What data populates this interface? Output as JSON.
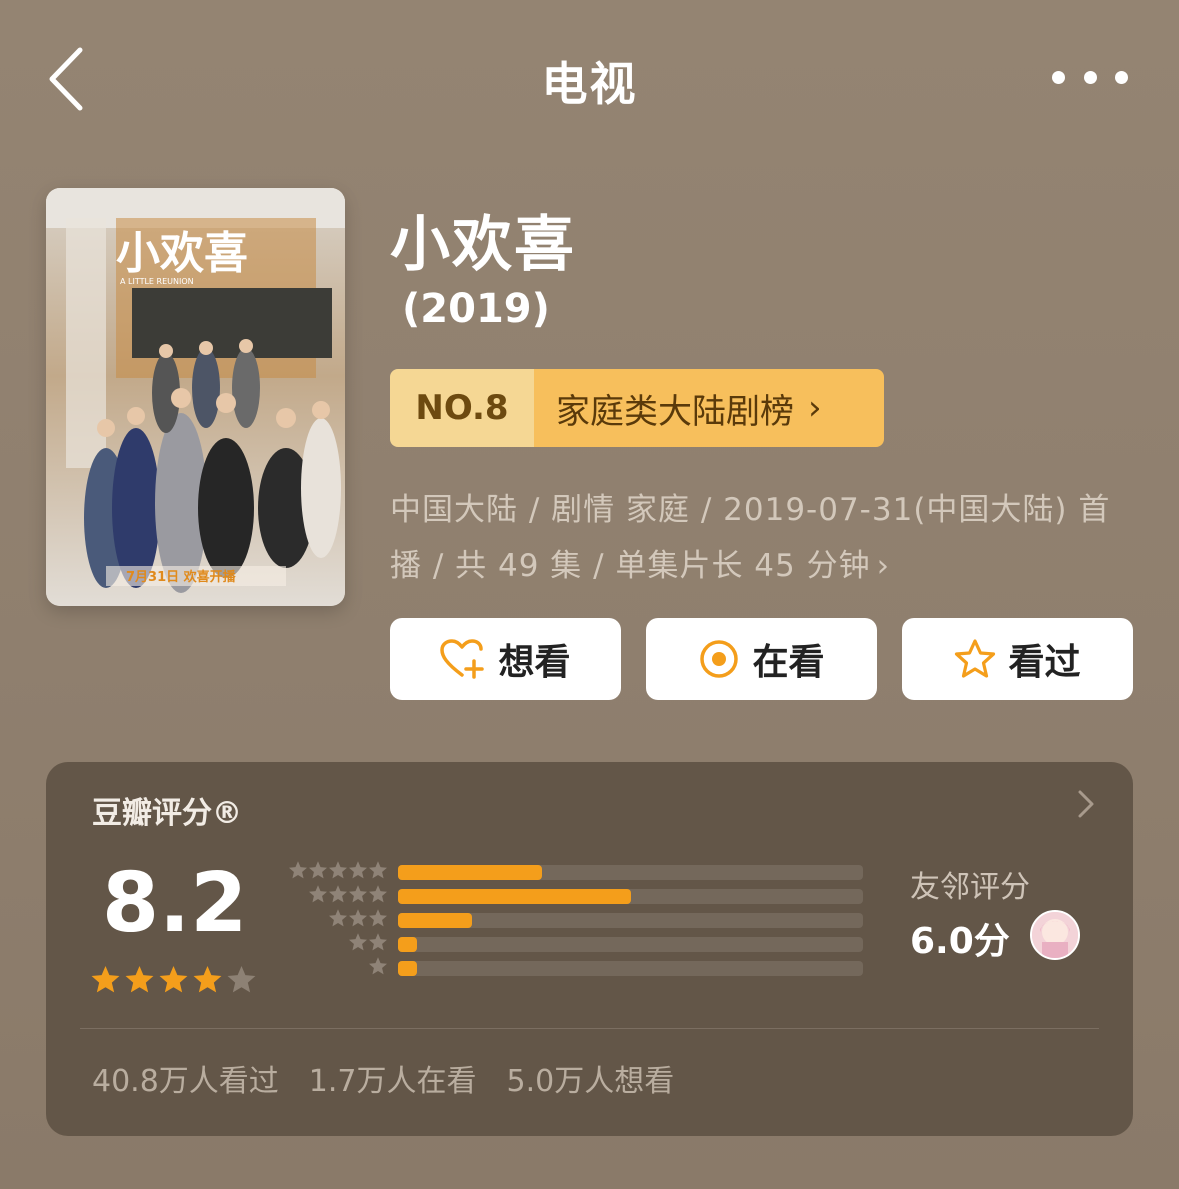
{
  "header": {
    "title": "电视"
  },
  "poster": {
    "logo_text": "小欢喜",
    "subtitle": "A LITTLE REUNION",
    "date_text": "7月31日 欢喜开播"
  },
  "show": {
    "title": "小欢喜",
    "year": "(2019)"
  },
  "rank": {
    "number": "NO.8",
    "list_name": "家庭类大陆剧榜",
    "chevron": "›"
  },
  "meta": {
    "line1": "中国大陆 / 剧情 家庭 / 2019-07-31(中国大陆) 首",
    "line2": "播 / 共 49 集 / 单集片长 45 分钟",
    "chevron": "›"
  },
  "actions": [
    {
      "label": "想看",
      "icon": "heart-plus-icon"
    },
    {
      "label": "在看",
      "icon": "target-circle-icon"
    },
    {
      "label": "看过",
      "icon": "star-outline-icon"
    }
  ],
  "rating": {
    "title": "豆瓣评分®",
    "score": "8.2",
    "stars": 4,
    "distribution": [
      {
        "stars": 5,
        "percent": 31
      },
      {
        "stars": 4,
        "percent": 50
      },
      {
        "stars": 3,
        "percent": 16
      },
      {
        "stars": 2,
        "percent": 4
      },
      {
        "stars": 1,
        "percent": 4
      }
    ],
    "neighbor_label": "友邻评分",
    "neighbor_score": "6.0分",
    "stats": [
      "40.8万人看过",
      "1.7万人在看",
      "5.0万人想看"
    ]
  },
  "colors": {
    "accent": "#f49e1b",
    "badge_light": "#f5d794",
    "badge_dark": "#f7bf5c",
    "card": "#635648"
  }
}
